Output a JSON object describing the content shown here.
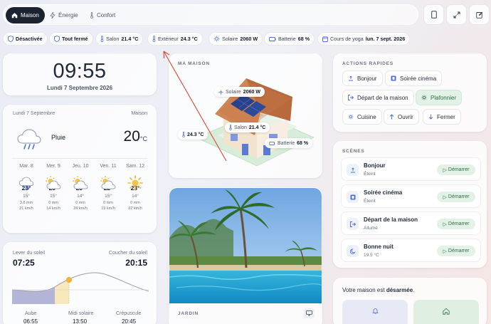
{
  "nav": {
    "tabs": [
      {
        "label": "Maison",
        "icon": "home-icon",
        "active": true
      },
      {
        "label": "Énergie",
        "icon": "lightning-icon",
        "active": false
      },
      {
        "label": "Confort",
        "icon": "thermometer-icon",
        "active": false
      }
    ]
  },
  "chips": [
    {
      "label": "Désactivée",
      "value": "",
      "icon": "shield-icon"
    },
    {
      "label": "Tout fermé",
      "value": "",
      "icon": "door-icon"
    },
    {
      "label": "Salon",
      "value": "21.4 °C",
      "icon": "thermometer-icon"
    },
    {
      "label": "Extérieur",
      "value": "24.3 °C",
      "icon": "thermometer-icon"
    },
    {
      "label": "Solaire",
      "value": "2060 W",
      "icon": "sun-icon"
    },
    {
      "label": "Batterie",
      "value": "68 %",
      "icon": "battery-icon"
    },
    {
      "label": "Cours de yoga",
      "value": "lun. 7 sept. 2026",
      "icon": "calendar-icon"
    }
  ],
  "clock": {
    "time": "09:55",
    "date": "Lundi 7 Septembre 2026"
  },
  "weather": {
    "date": "Lundi 7 Septembre",
    "location": "Maison",
    "condition": "Pluie",
    "temp": "20",
    "unit": "°C",
    "forecast": [
      {
        "day": "Mar. 8",
        "icon": "rain-cloud-icon",
        "high": "23°",
        "low": "15°",
        "precip": "3.8 mm",
        "wind": "21 km/h"
      },
      {
        "day": "Mer. 9",
        "icon": "partly-cloudy-icon",
        "high": "23°",
        "low": "15°",
        "precip": "0 mm",
        "wind": "14 km/h"
      },
      {
        "day": "Jeu. 10",
        "icon": "partly-cloudy-icon",
        "high": "23°",
        "low": "14°",
        "precip": "0 mm",
        "wind": "24 km/h"
      },
      {
        "day": "Ven. 11",
        "icon": "partly-cloudy-icon",
        "high": "22°",
        "low": "15°",
        "precip": "0 mm",
        "wind": "19 km/h"
      },
      {
        "day": "Sam. 12",
        "icon": "sun-icon",
        "high": "23°",
        "low": "14°",
        "precip": "0 mm",
        "wind": "22 km/h"
      }
    ]
  },
  "sun": {
    "sunrise_label": "Lever du soleil",
    "sunrise": "07:25",
    "sunset_label": "Coucher du soleil",
    "sunset": "20:15",
    "dawn_label": "Aube",
    "dawn": "06:55",
    "noon_label": "Midi solaire",
    "noon": "13:50",
    "dusk_label": "Crépuscule",
    "dusk": "20:45"
  },
  "house": {
    "title": "MA MAISON",
    "solar_label": "Solaire",
    "solar": "2060 W",
    "outside": "24.3 °C",
    "salon_label": "Salon",
    "salon": "21.4 °C",
    "battery_label": "Batterie",
    "battery": "68 %"
  },
  "garden": {
    "title": "JARDIN"
  },
  "quick": {
    "title": "ACTIONS RAPIDES",
    "actions": [
      {
        "label": "Bonjour",
        "icon": "sunrise-icon",
        "active": false
      },
      {
        "label": "Soirée cinéma",
        "icon": "film-icon",
        "active": false
      },
      {
        "label": "Départ de la maison",
        "icon": "logout-icon",
        "active": false
      },
      {
        "label": "Plafonnier",
        "icon": "light-icon",
        "active": true
      },
      {
        "label": "Cuisine",
        "icon": "light-icon",
        "active": false
      },
      {
        "label": "Ouvrir",
        "icon": "arrow-up-icon",
        "active": false
      },
      {
        "label": "Fermer",
        "icon": "arrow-down-icon",
        "active": false
      }
    ]
  },
  "scenes": {
    "title": "SCÈNES",
    "button": "Démarrer",
    "items": [
      {
        "name": "Bonjour",
        "status": "Éteint",
        "icon": "sunrise-icon"
      },
      {
        "name": "Soirée cinéma",
        "status": "Éteint",
        "icon": "film-icon"
      },
      {
        "name": "Départ de la maison",
        "status": "Allumé",
        "icon": "logout-icon"
      },
      {
        "name": "Bonne nuit",
        "status": "19.5 °C",
        "icon": "moon-icon"
      }
    ]
  },
  "alarm": {
    "prefix": "Votre maison est ",
    "state": "désarmée",
    "suffix": "."
  },
  "colors": {
    "accent": "#1c2330",
    "green_bg": "#e3f2e7",
    "green_text": "#2f6b45",
    "annotation": "#e0462f"
  }
}
